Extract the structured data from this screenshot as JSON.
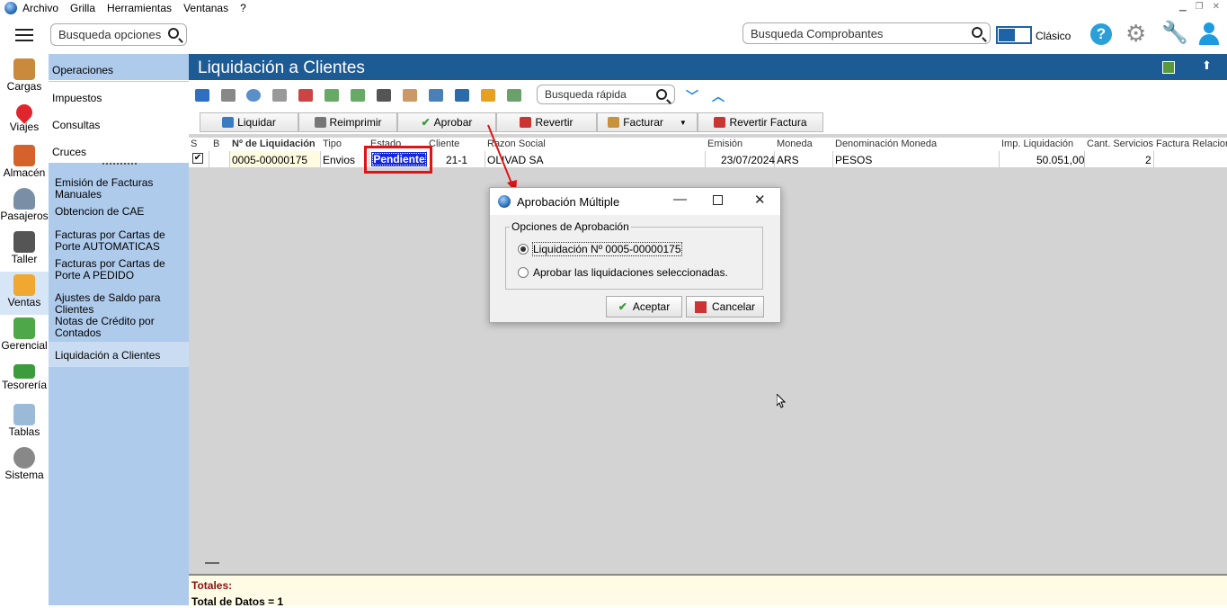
{
  "menubar": {
    "items": [
      "Archivo",
      "Grilla",
      "Herramientas",
      "Ventanas",
      "?"
    ]
  },
  "topbar": {
    "search_options_placeholder": "Busqueda opciones",
    "search_comprobantes_placeholder": "Busqueda Comprobantes",
    "toggle_label": "Clásico"
  },
  "leftnav": {
    "items": [
      "Cargas",
      "Viajes",
      "Almacén",
      "Pasajeros",
      "Taller",
      "Ventas",
      "Gerencial",
      "Tesorería",
      "Tablas",
      "Sistema"
    ],
    "active": "Ventas"
  },
  "menu": {
    "top": [
      "Operaciones",
      "Impuestos",
      "Consultas",
      "Cruces"
    ],
    "sub": [
      "Emisión de Facturas Manuales",
      "Obtencion de CAE",
      "Facturas por Cartas de Porte AUTOMATICAS",
      "Facturas por Cartas de Porte A PEDIDO",
      "Ajustes de Saldo para Clientes",
      "Notas de Crédito por Contados",
      "Liquidación a Clientes"
    ],
    "selected": "Liquidación a Clientes"
  },
  "content": {
    "title": "Liquidación a Clientes",
    "quick_search_placeholder": "Busqueda rápida"
  },
  "actions": {
    "liquidar": "Liquidar",
    "reimprimir": "Reimprimir",
    "aprobar": "Aprobar",
    "revertir": "Revertir",
    "facturar": "Facturar",
    "revertir_factura": "Revertir Factura"
  },
  "grid": {
    "columns": [
      "S",
      "B",
      "Nº de Liquidación",
      "Tipo",
      "Estado",
      "Cliente",
      "Razon Social",
      "Emisión",
      "Moneda",
      "Denominación Moneda",
      "Imp. Liquidación",
      "Cant. Servicios",
      "Factura Relacion"
    ],
    "rows": [
      {
        "s": "✔",
        "b": "",
        "nro": "0005-00000175",
        "tipo": "Envios",
        "estado": "Pendiente",
        "cliente": "21-1",
        "razon": "OLIVAD SA",
        "emision": "23/07/2024",
        "moneda": "ARS",
        "denominacion": "PESOS",
        "importe": "50.051,00",
        "cantidad": "2",
        "factura": ""
      }
    ]
  },
  "totals": {
    "label": "Totales:",
    "count": "Total de Datos = 1"
  },
  "dialog": {
    "title": "Aprobación Múltiple",
    "group": "Opciones de Aprobación",
    "option1": "Liquidación Nº 0005-00000175",
    "option2": "Aprobar las liquidaciones seleccionadas.",
    "selected_option": 1,
    "accept": "Aceptar",
    "cancel": "Cancelar"
  },
  "colors": {
    "header_blue": "#1d5b95",
    "menu_blue": "#aecbec",
    "estado_highlight": "#e01414",
    "estado_bg": "#1228d8"
  }
}
